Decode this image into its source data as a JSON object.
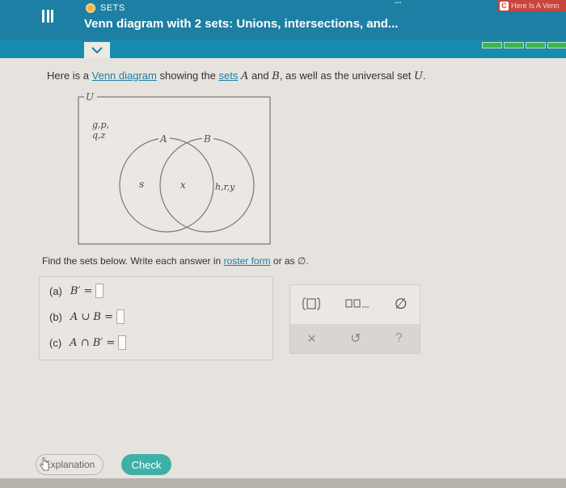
{
  "header": {
    "topic": "SETS",
    "title": "Venn diagram with 2 sets: Unions, intersections, and...",
    "user_name": "...",
    "tab_badge_icon": "C",
    "tab_badge_text": "Here Is A Venn",
    "progress_segments": 4,
    "colors": {
      "header": "#1d7fa3",
      "progress": "#3fb34f",
      "tab_badge": "#c7453d"
    }
  },
  "question": {
    "prompt_prefix": "Here is a ",
    "prompt_link": "Venn diagram",
    "prompt_mid": " showing the ",
    "prompt_link2": "sets",
    "prompt_var_a": "A",
    "prompt_and": " and ",
    "prompt_var_b": "B",
    "prompt_suffix": ", as well as the universal set ",
    "prompt_var_u": "U",
    "prompt_end": "."
  },
  "venn": {
    "universal_label": "U",
    "set_a_label": "A",
    "set_b_label": "B",
    "outside_elements_line1": "g,p,",
    "outside_elements_line2": "q,z",
    "only_a": "s",
    "intersection": "x",
    "only_b": "h,r,y"
  },
  "instructions": {
    "prefix": "Find the sets below. Write each answer in ",
    "link": "roster form",
    "suffix": " or as ∅."
  },
  "answers": [
    {
      "label": "(a)",
      "expr": "B′ ="
    },
    {
      "label": "(b)",
      "expr": "A ∪ B ="
    },
    {
      "label": "(c)",
      "expr": "A ∩ B′ ="
    }
  ],
  "toolbox": {
    "tools": [
      {
        "icon": "curly-braces-icon"
      },
      {
        "icon": "list-icon"
      },
      {
        "icon": "empty-set-icon",
        "glyph": "∅"
      }
    ],
    "actions": [
      {
        "icon": "x-icon",
        "glyph": "×"
      },
      {
        "icon": "undo-icon",
        "glyph": "↺"
      },
      {
        "icon": "help-icon",
        "glyph": "?"
      }
    ]
  },
  "buttons": {
    "explanation": "Explanation",
    "check": "Check"
  }
}
